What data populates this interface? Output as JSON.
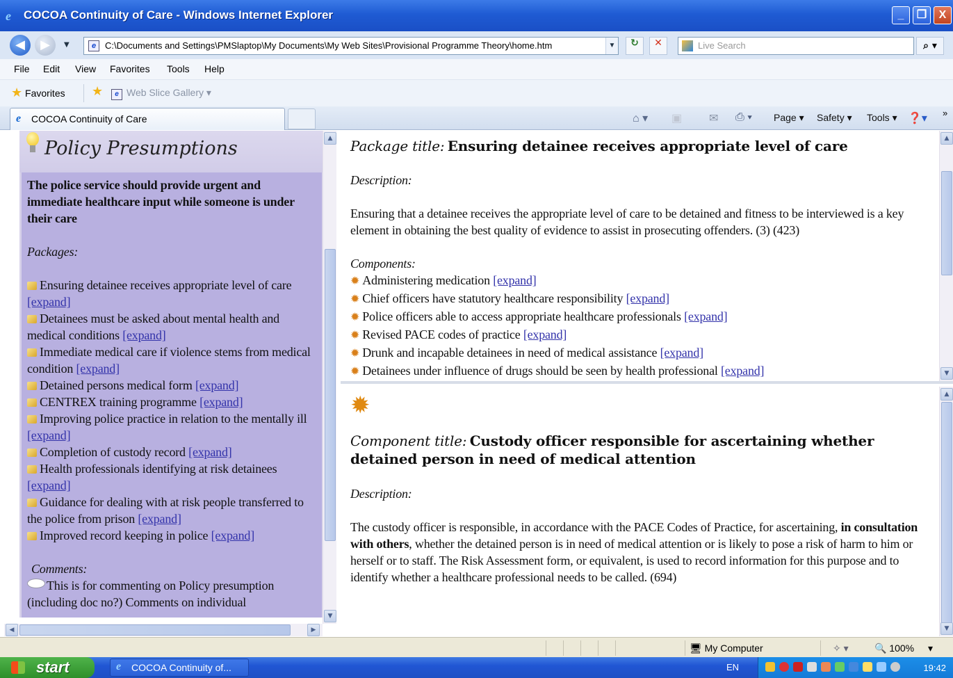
{
  "window": {
    "title": "COCOA Continuity of Care - Windows Internet Explorer",
    "minimize": "_",
    "restore": "❐",
    "close": "X"
  },
  "address": {
    "url": "C:\\Documents and Settings\\PMSlaptop\\My Documents\\My Web Sites\\Provisional Programme Theory\\home.htm",
    "search_placeholder": "Live Search"
  },
  "menu": [
    "File",
    "Edit",
    "View",
    "Favorites",
    "Tools",
    "Help"
  ],
  "favorites_bar": {
    "favorites_label": "Favorites",
    "web_slice": "Web Slice Gallery ▾"
  },
  "tab": {
    "label": "COCOA Continuity of Care"
  },
  "commands": {
    "page": "Page ▾",
    "safety": "Safety ▾",
    "tools": "Tools ▾"
  },
  "left": {
    "heading": "Policy Presumptions",
    "lead": "The police service should provide urgent and immediate healthcare input while someone is under their care",
    "packages_label": "Packages:",
    "expand_label": "[expand]",
    "packages": [
      "Ensuring detainee receives appropriate level of care",
      "Detainees must be asked about mental health and medical conditions",
      "Immediate medical care if violence stems from medical condition",
      "Detained persons medical form",
      "CENTREX training programme",
      "Improving police practice in relation to the mentally ill",
      "Completion of custody record",
      "Health professionals identifying at risk detainees",
      "Guidance for dealing with at risk people transferred to the police from prison ",
      "Improved record keeping in police"
    ],
    "comments_label": "Comments:",
    "comment_text": "This is for commenting on Policy presumption (including doc no?) Comments on individual"
  },
  "package": {
    "title_label": "Package title:",
    "title": "Ensuring detainee receives appropriate level of care",
    "description_label": "Description:",
    "description": "Ensuring that a detainee receives the appropriate level of care to be detained and fitness to be interviewed is a key element in obtaining the best quality of evidence to assist in prosecuting offenders. (3) (423)",
    "components_label": "Components:",
    "components": [
      "Administering medication",
      "Chief officers have statutory healthcare responsibility",
      "Police officers able to access appropriate healthcare professionals",
      "Revised PACE codes of practice",
      "Drunk and incapable detainees in need of medical assistance",
      "Detainees under influence of drugs should be seen by health professional"
    ]
  },
  "component": {
    "title_label": "Component title:",
    "title": "Custody officer responsible for ascertaining whether detained person in need of medical attention",
    "description_label": "Description:",
    "desc_part1": "The custody officer is responsible, in accordance with the PACE Codes of Practice, for ascertaining, ",
    "desc_bold": "in consultation with others",
    "desc_part2": ", whether the detained person is in need of medical attention or is likely to pose a risk of harm to him or herself or to staff. The Risk Assessment form, or equivalent, is used to record information for this purpose and to identify whether a healthcare professional needs to be called. (694)"
  },
  "status": {
    "zone": "My Computer",
    "zoom": "100%"
  },
  "taskbar": {
    "start": "start",
    "item": "COCOA Continuity of...",
    "lang": "EN",
    "clock": "19:42"
  }
}
